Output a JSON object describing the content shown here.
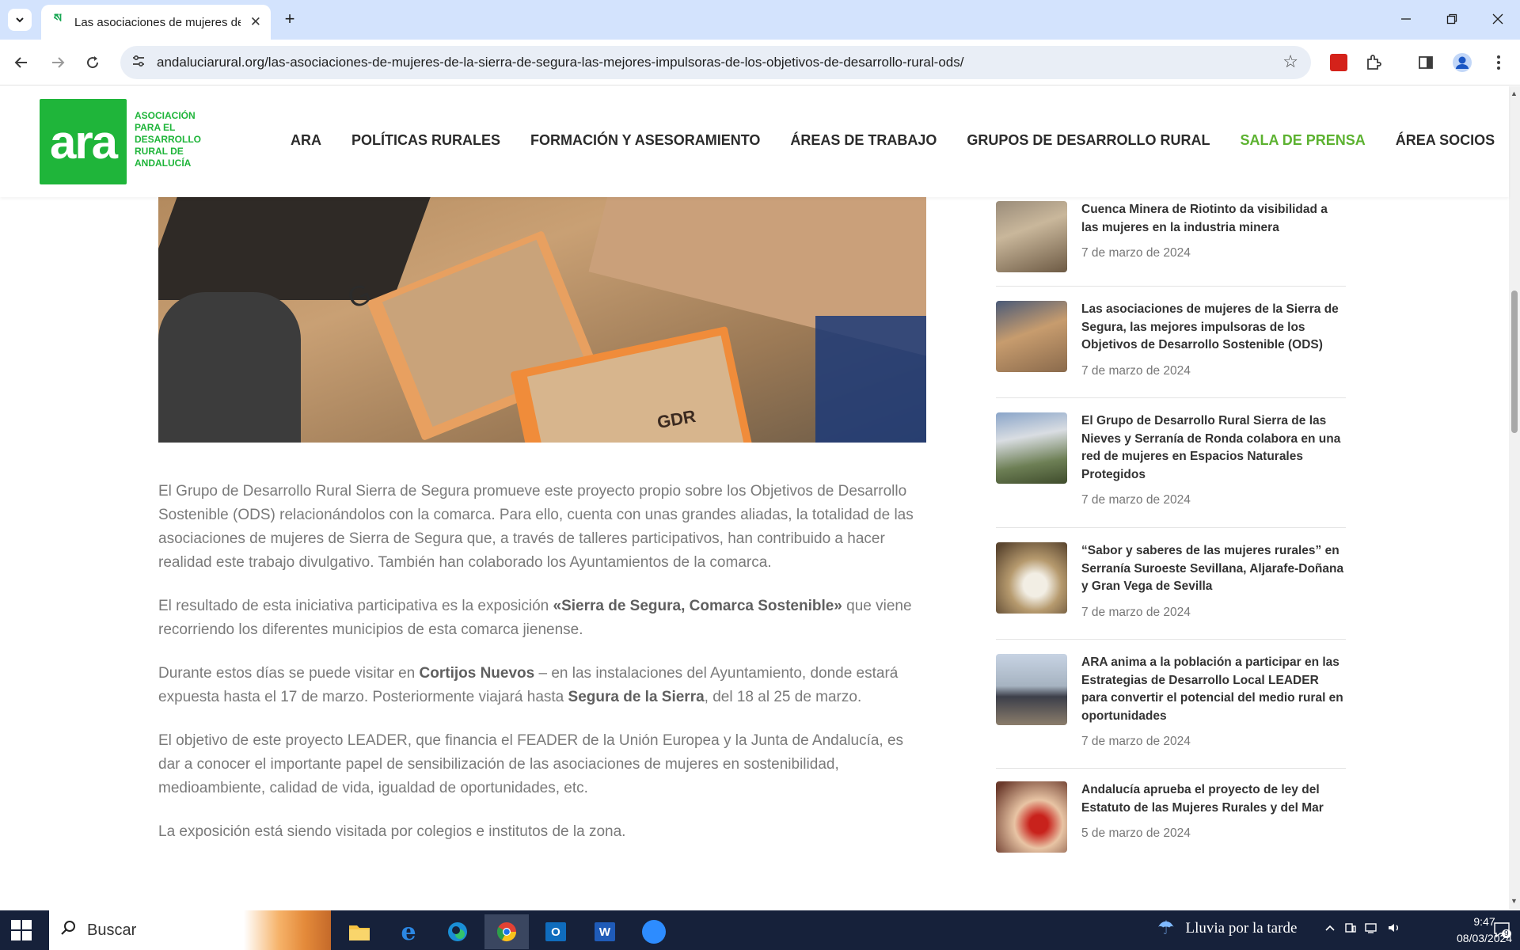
{
  "browser": {
    "tab_title": "Las asociaciones de mujeres de",
    "url": "andaluciarural.org/las-asociaciones-de-mujeres-de-la-sierra-de-segura-las-mejores-impulsoras-de-los-objetivos-de-desarrollo-rural-ods/"
  },
  "site": {
    "logo_text": "ara",
    "logo_subtitle": "ASOCIACIÓN PARA EL DESARROLLO RURAL DE ANDALUCÍA",
    "nav": [
      {
        "label": "ARA"
      },
      {
        "label": "POLÍTICAS RURALES"
      },
      {
        "label": "FORMACIÓN Y ASESORAMIENTO"
      },
      {
        "label": "ÁREAS DE TRABAJO"
      },
      {
        "label": "GRUPOS DE DESARROLLO RURAL"
      },
      {
        "label": "SALA DE PRENSA"
      },
      {
        "label": "ÁREA SOCIOS"
      }
    ],
    "active_nav_color": "#5cb230",
    "brand_color": "#1fb53a"
  },
  "article": {
    "image_label": "GDR",
    "p1": "El Grupo de Desarrollo Rural Sierra de Segura promueve este proyecto propio sobre los Objetivos de Desarrollo Sostenible (ODS) relacionándolos con la comarca. Para ello, cuenta con unas grandes aliadas, la totalidad de las asociaciones de mujeres de Sierra de Segura que, a través de talleres participativos, han contribuido a hacer realidad este trabajo divulgativo. También han colaborado los Ayuntamientos de la comarca.",
    "p2_a": "El resultado de esta iniciativa participativa es la exposición ",
    "p2_bold": "«Sierra de Segura, Comarca Sostenible»",
    "p2_b": "  que viene recorriendo los diferentes municipios de esta comarca jienense.",
    "p3_a": "Durante estos días se puede visitar en ",
    "p3_bold1": "Cortijos Nuevos",
    "p3_b": " – en las instalaciones del Ayuntamiento, donde estará expuesta hasta el 17 de marzo. Posteriormente viajará hasta ",
    "p3_bold2": "Segura de la Sierra",
    "p3_c": ", del 18 al 25 de marzo.",
    "p4": "El objetivo de este proyecto LEADER, que financia el FEADER de la Unión Europea y la Junta de Andalucía, es dar a conocer el importante papel de sensibilización de las asociaciones de mujeres en sostenibilidad, medioambiente, calidad de vida, igualdad de oportunidades, etc.",
    "p5": "La exposición está siendo visitada por colegios e institutos de la zona."
  },
  "sidebar": {
    "posts": [
      {
        "title": "Cuenca Minera de Riotinto da visibilidad a las mujeres en la industria minera",
        "date": "7 de marzo de 2024"
      },
      {
        "title": "Las asociaciones de mujeres de la Sierra de Segura, las mejores impulsoras de los Objetivos de Desarrollo Sostenible (ODS)",
        "date": "7 de marzo de 2024"
      },
      {
        "title": "El Grupo de Desarrollo Rural Sierra de las Nieves y Serranía de Ronda colabora en una red de mujeres en Espacios Naturales Protegidos",
        "date": "7 de marzo de 2024"
      },
      {
        "title": "“Sabor y saberes de las mujeres rurales” en Serranía Suroeste Sevillana, Aljarafe-Doñana y Gran Vega de Sevilla",
        "date": "7 de marzo de 2024"
      },
      {
        "title": "ARA anima a la población a participar en las Estrategias de Desarrollo Local LEADER para convertir el potencial del medio rural en oportunidades",
        "date": "7 de marzo de 2024"
      },
      {
        "title": "Andalucía aprueba el proyecto de ley del Estatuto de las Mujeres Rurales y del Mar",
        "date": "5 de marzo de 2024"
      }
    ]
  },
  "taskbar": {
    "search_placeholder": "Buscar",
    "weather": "Lluvia por la tarde",
    "time": "9:47",
    "date": "08/03/2024",
    "notifications": "9"
  }
}
